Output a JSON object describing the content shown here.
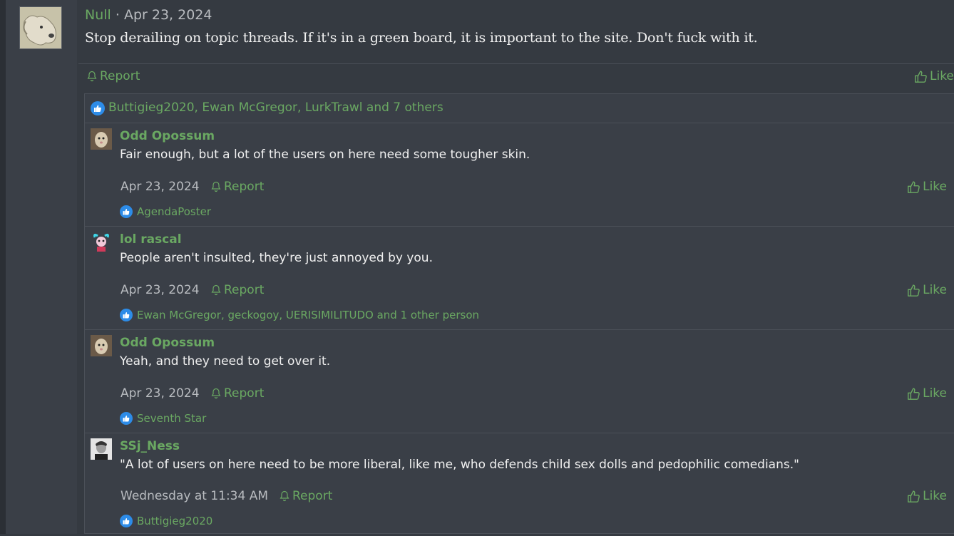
{
  "post": {
    "author": "Null",
    "date": "Apr 23, 2024",
    "separator": "·",
    "body": "Stop derailing on topic threads. If it's in a green board, it is important to the site. Don't fuck with it.",
    "report_label": "Report",
    "like_label": "Like",
    "reactions_text": "Buttigieg2020, Ewan McGregor, LurkTrawl and 7 others"
  },
  "replies": [
    {
      "author": "Odd Opossum",
      "text": "Fair enough, but a lot of the users on here need some tougher skin.",
      "date": "Apr 23, 2024",
      "report_label": "Report",
      "like_label": "Like",
      "likers": "AgendaPoster"
    },
    {
      "author": "lol rascal",
      "text": "People aren't insulted, they're just annoyed by you.",
      "date": "Apr 23, 2024",
      "report_label": "Report",
      "like_label": "Like",
      "likers": "Ewan McGregor, geckogoy, UERISIMILITUDO and 1 other person"
    },
    {
      "author": "Odd Opossum",
      "text": "Yeah, and they need to get over it.",
      "date": "Apr 23, 2024",
      "report_label": "Report",
      "like_label": "Like",
      "likers": "Seventh Star"
    },
    {
      "author": "SSj_Ness",
      "text": "\"A lot of users on here need to be more liberal, like me, who defends child sex dolls and pedophilic comedians.\"",
      "date": "Wednesday at 11:34 AM",
      "report_label": "Report",
      "like_label": "Like",
      "likers": "Buttigieg2020"
    }
  ],
  "colors": {
    "accent": "#6aa862",
    "background": "#353a41",
    "panel": "#3a3f47",
    "like_badge": "#2d8ce8"
  },
  "icons": {
    "report": "bell-icon",
    "like": "thumbs-up-icon",
    "reaction": "like-reaction-icon"
  }
}
